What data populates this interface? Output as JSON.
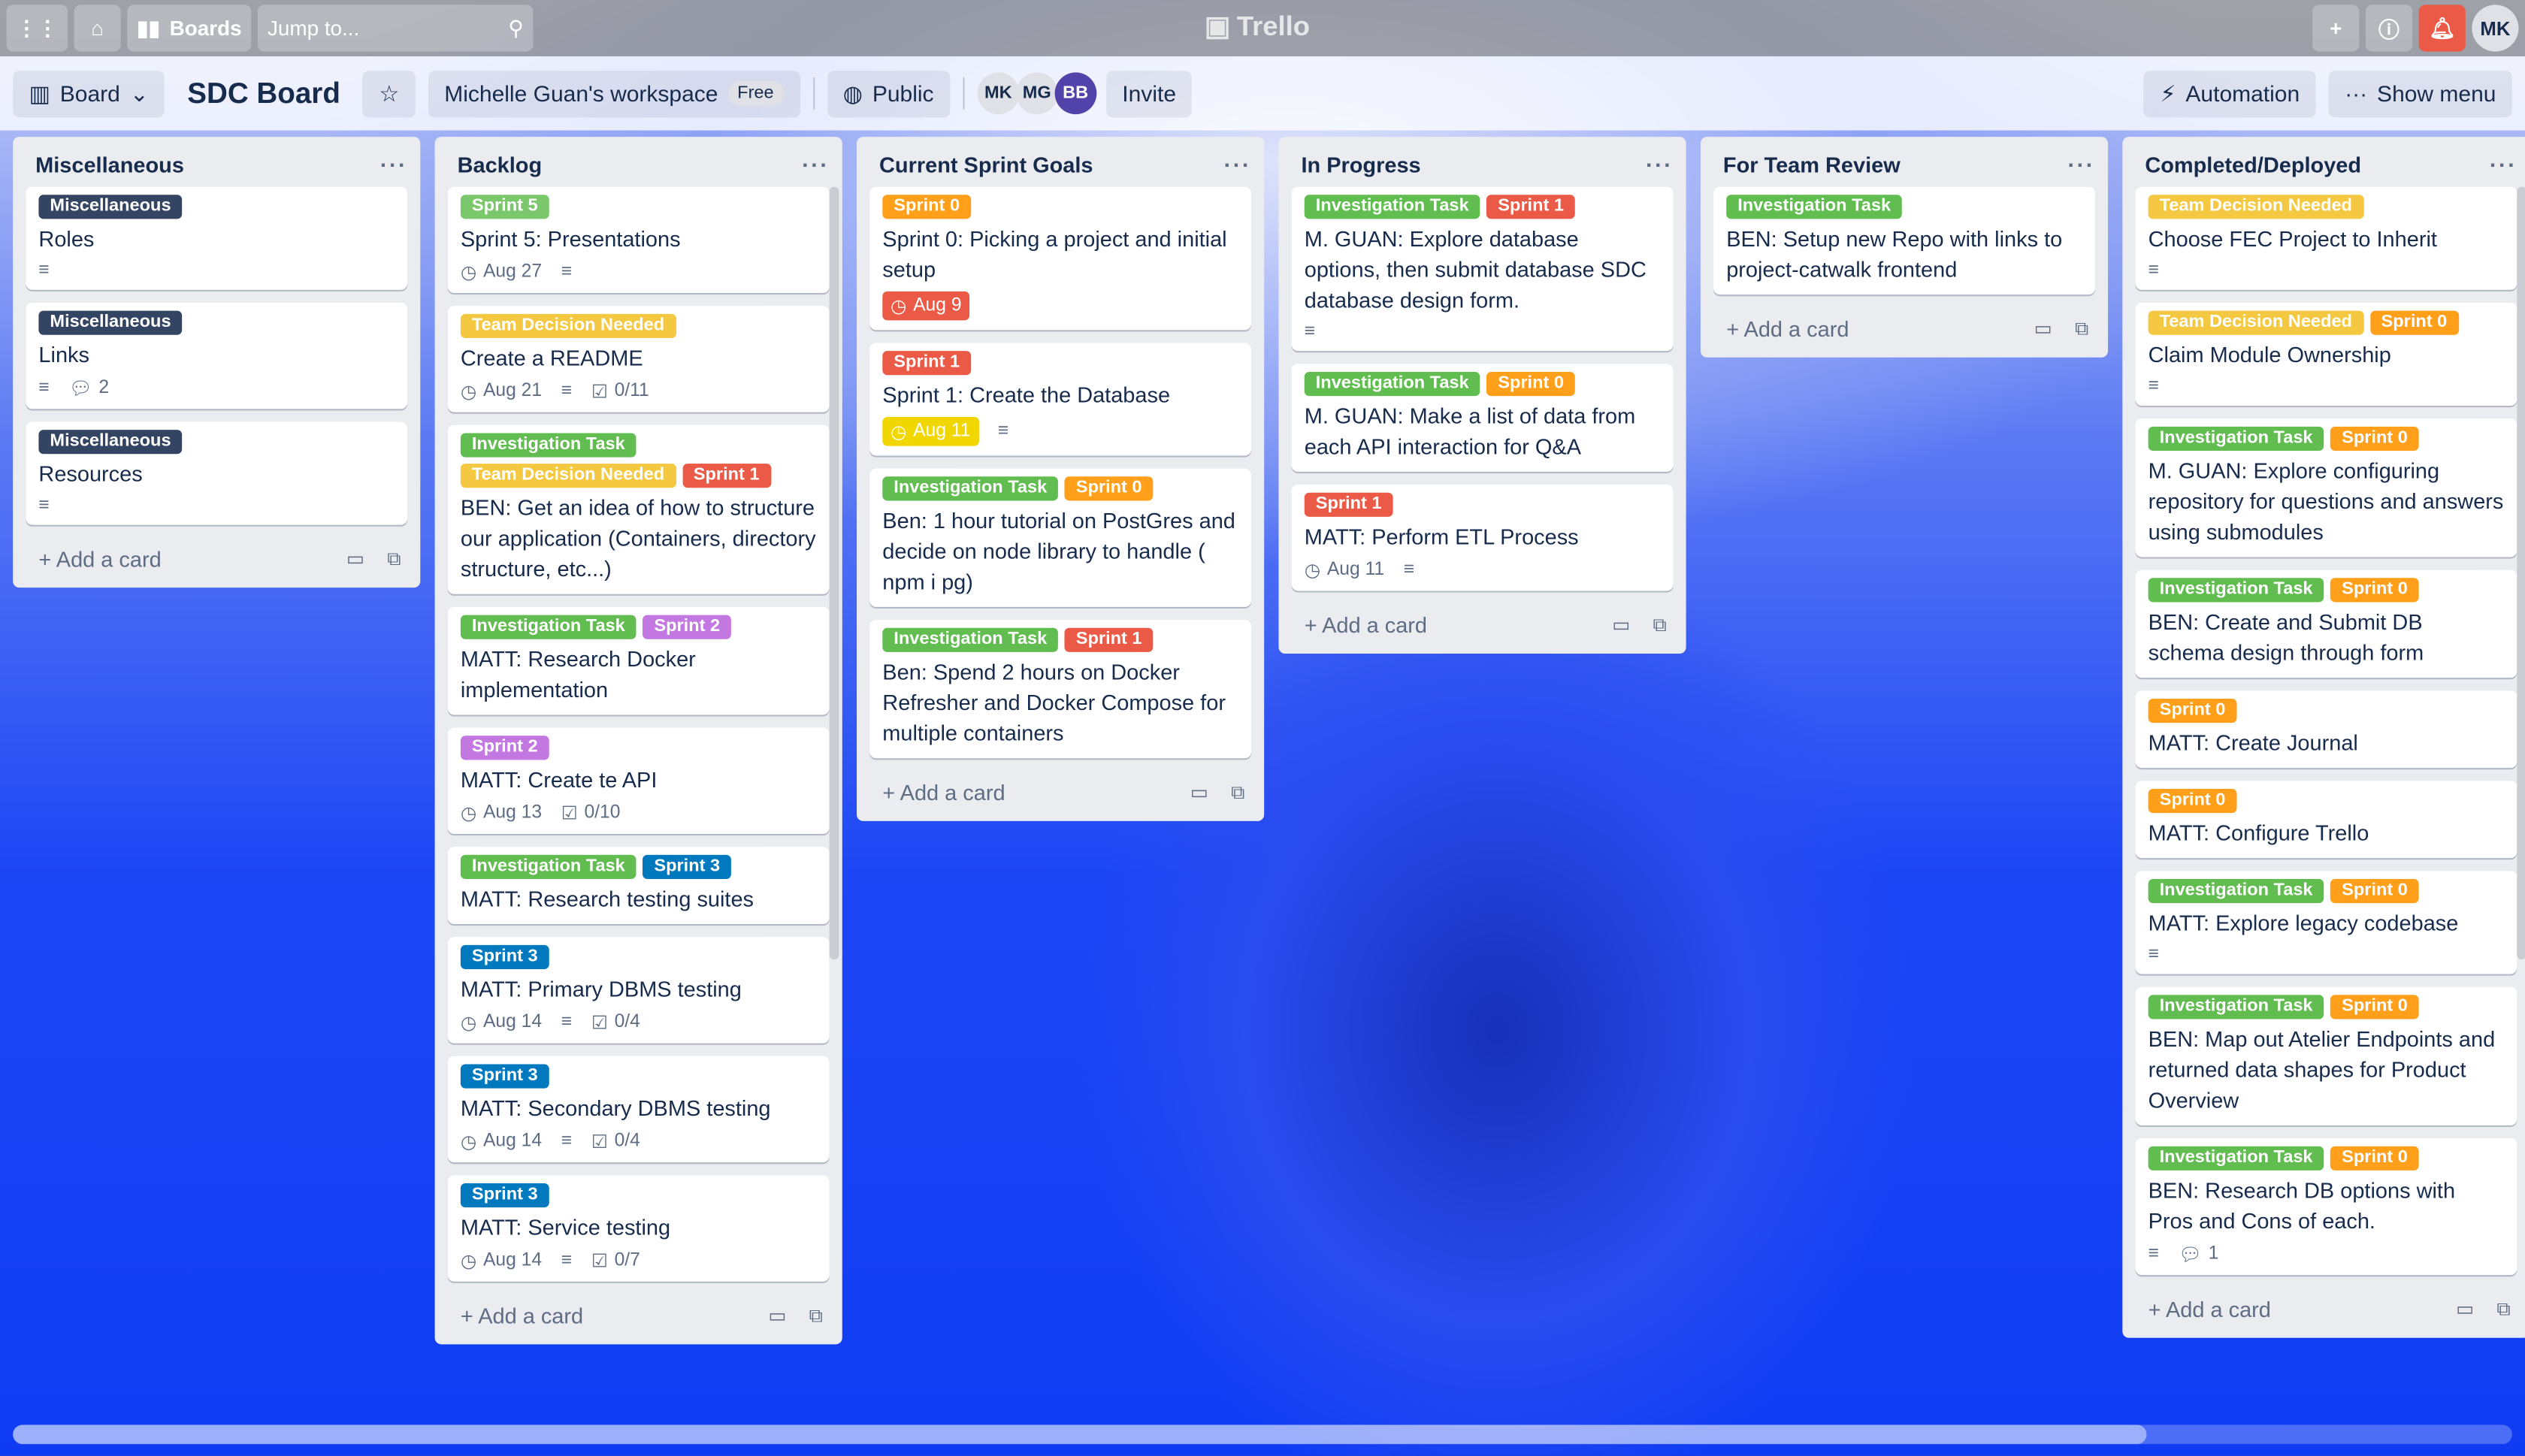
{
  "topbar": {
    "apps_icon": "grid-icon",
    "home_icon": "home-icon",
    "boards_label": "Boards",
    "search_placeholder": "Jump to...",
    "logo": "Trello",
    "user_initials": "MK"
  },
  "boardbar": {
    "view_label": "Board",
    "board_title": "SDC Board",
    "workspace": "Michelle Guan's workspace",
    "plan": "Free",
    "visibility": "Public",
    "members": [
      "MK",
      "MG",
      "BB"
    ],
    "invite": "Invite",
    "automation": "Automation",
    "show_menu": "Show menu"
  },
  "label_colors": {
    "Miscellaneous": "#344563",
    "Sprint 5": "#7bc86c",
    "Team Decision Needed": "#f5c842",
    "Investigation Task": "#61bd4f",
    "Sprint 0": "#ff9f1a",
    "Sprint 1": "#eb5a46",
    "Sprint 2": "#c377e0",
    "Sprint 3": "#0079bf"
  },
  "add_card_label": "Add a card",
  "lists": [
    {
      "title": "Miscellaneous",
      "cards": [
        {
          "labels": [
            "Miscellaneous"
          ],
          "title": "Roles",
          "desc": true
        },
        {
          "labels": [
            "Miscellaneous"
          ],
          "title": "Links",
          "desc": true,
          "comments": "2"
        },
        {
          "labels": [
            "Miscellaneous"
          ],
          "title": "Resources",
          "desc": true
        }
      ]
    },
    {
      "title": "Backlog",
      "scroll": true,
      "cards": [
        {
          "labels": [
            "Sprint 5"
          ],
          "title": "Sprint 5: Presentations",
          "due": "Aug 27",
          "desc": true
        },
        {
          "labels": [
            "Team Decision Needed"
          ],
          "title": "Create a README",
          "due": "Aug 21",
          "desc": true,
          "checklist": "0/11"
        },
        {
          "labels": [
            "Investigation Task",
            "Team Decision Needed",
            "Sprint 1"
          ],
          "title": "BEN: Get an idea of how to structure our application (Containers, directory structure, etc...)"
        },
        {
          "labels": [
            "Investigation Task",
            "Sprint 2"
          ],
          "title": "MATT: Research Docker implementation"
        },
        {
          "labels": [
            "Sprint 2"
          ],
          "title": "MATT: Create te API",
          "due": "Aug 13",
          "checklist": "0/10"
        },
        {
          "labels": [
            "Investigation Task",
            "Sprint 3"
          ],
          "title": "MATT: Research testing suites"
        },
        {
          "labels": [
            "Sprint 3"
          ],
          "title": "MATT: Primary DBMS testing",
          "due": "Aug 14",
          "desc": true,
          "checklist": "0/4"
        },
        {
          "labels": [
            "Sprint 3"
          ],
          "title": "MATT: Secondary DBMS testing",
          "due": "Aug 14",
          "desc": true,
          "checklist": "0/4"
        },
        {
          "labels": [
            "Sprint 3"
          ],
          "title": "MATT: Service testing",
          "due": "Aug 14",
          "desc": true,
          "checklist": "0/7"
        }
      ]
    },
    {
      "title": "Current Sprint Goals",
      "cards": [
        {
          "labels": [
            "Sprint 0"
          ],
          "title": "Sprint 0: Picking a project and initial setup",
          "due": "Aug 9",
          "due_status": "overdue"
        },
        {
          "labels": [
            "Sprint 1"
          ],
          "title": "Sprint 1: Create the Database",
          "due": "Aug 11",
          "due_status": "due-soon",
          "desc": true
        },
        {
          "labels": [
            "Investigation Task",
            "Sprint 0"
          ],
          "title": "Ben: 1 hour tutorial on PostGres and decide on node library to handle ( npm i pg)"
        },
        {
          "labels": [
            "Investigation Task",
            "Sprint 1"
          ],
          "title": "Ben: Spend 2 hours on Docker Refresher and Docker Compose for multiple containers"
        }
      ]
    },
    {
      "title": "In Progress",
      "cards": [
        {
          "labels": [
            "Investigation Task",
            "Sprint 1"
          ],
          "title": "M. GUAN: Explore database options, then submit database SDC database design form.",
          "desc": true
        },
        {
          "labels": [
            "Investigation Task",
            "Sprint 0"
          ],
          "title": "M. GUAN: Make a list of data from each API interaction for Q&A"
        },
        {
          "labels": [
            "Sprint 1"
          ],
          "title": "MATT: Perform ETL Process",
          "due": "Aug 11",
          "desc": true
        }
      ]
    },
    {
      "title": "For Team Review",
      "cards": [
        {
          "labels": [
            "Investigation Task"
          ],
          "title": "BEN: Setup new Repo with links to project-catwalk frontend"
        }
      ]
    },
    {
      "title": "Completed/Deployed",
      "scroll": true,
      "cards": [
        {
          "labels": [
            "Team Decision Needed"
          ],
          "title": "Choose FEC Project to Inherit",
          "desc": true
        },
        {
          "labels": [
            "Team Decision Needed",
            "Sprint 0"
          ],
          "title": "Claim Module Ownership",
          "desc": true
        },
        {
          "labels": [
            "Investigation Task",
            "Sprint 0"
          ],
          "title": "M. GUAN: Explore configuring repository for questions and answers using submodules"
        },
        {
          "labels": [
            "Investigation Task",
            "Sprint 0"
          ],
          "title": "BEN: Create and Submit DB schema design through form"
        },
        {
          "labels": [
            "Sprint 0"
          ],
          "title": "MATT: Create Journal"
        },
        {
          "labels": [
            "Sprint 0"
          ],
          "title": "MATT: Configure Trello"
        },
        {
          "labels": [
            "Investigation Task",
            "Sprint 0"
          ],
          "title": "MATT: Explore legacy codebase",
          "desc": true
        },
        {
          "labels": [
            "Investigation Task",
            "Sprint 0"
          ],
          "title": "BEN: Map out Atelier Endpoints and returned data shapes for Product Overview"
        },
        {
          "labels": [
            "Investigation Task",
            "Sprint 0"
          ],
          "title": "BEN: Research DB options with Pros and Cons of each.",
          "desc": true,
          "comments": "1"
        }
      ]
    }
  ]
}
